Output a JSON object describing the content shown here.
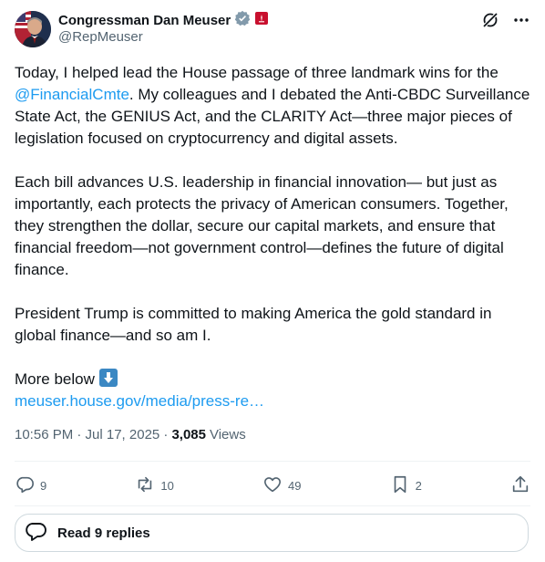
{
  "author": {
    "display_name": "Congressman Dan Meuser",
    "handle": "@RepMeuser"
  },
  "tweet": {
    "p1_a": "Today, I helped lead the House passage of three landmark wins for the ",
    "p1_mention": "@FinancialCmte",
    "p1_b": ". My colleagues and I debated the Anti-CBDC Surveillance State Act, the GENIUS Act, and the CLARITY Act—three major pieces of legislation focused on cryptocurrency and digital assets.",
    "p2": "Each bill advances U.S. leadership in financial innovation— but just as importantly, each protects the privacy of American consumers. Together, they strengthen the dollar, secure our capital markets, and ensure that financial freedom—not government control—defines the future of digital finance.",
    "p3": "President Trump is committed to making America the gold standard in global finance—and so am I.",
    "p4": "More below ",
    "link": "meuser.house.gov/media/press-re…"
  },
  "meta": {
    "time": "10:56 PM · Jul 17, 2025 ·",
    "views_count": "3,085",
    "views_label": "Views"
  },
  "actions": {
    "replies": "9",
    "reposts": "10",
    "likes": "49",
    "bookmarks": "2"
  },
  "read_replies_label": "Read 9 replies",
  "colors": {
    "accent": "#1d9bf0",
    "text": "#0f1419",
    "muted": "#536471",
    "verified_badge": "#829aab",
    "affiliate_badge": "#c8102e"
  },
  "icons": [
    "verified-badge-icon",
    "house-affiliation-icon",
    "grok-icon",
    "more-icon",
    "arrow-down-emoji-icon",
    "reply-icon",
    "repost-icon",
    "like-icon",
    "bookmark-icon",
    "share-icon",
    "replies-bubble-icon"
  ]
}
